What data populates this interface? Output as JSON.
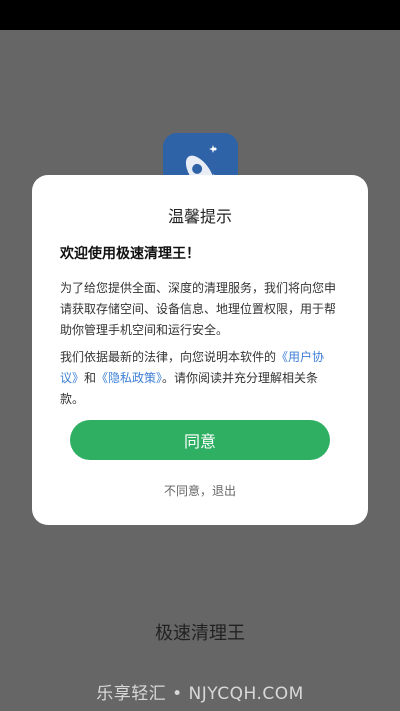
{
  "background": {
    "color": "#666666"
  },
  "app": {
    "icon": "rocket-icon",
    "name": "极速清理王"
  },
  "dialog": {
    "title": "温馨提示",
    "welcome": "欢迎使用极速清理王！",
    "paragraph1": "为了给您提供全面、深度的清理服务，我们将向您申请获取存储空间、设备信息、地理位置权限，用于帮助你管理手机空间和运行安全。",
    "paragraph2_part1": "我们依据最新的法律，向您说明本软件的",
    "user_agreement_link": "《用户协议》",
    "paragraph2_and": "和",
    "privacy_policy_link": "《隐私政策》",
    "paragraph2_part2": "。请你阅读并充分理解相关条款。",
    "agree_button": "同意",
    "disagree_label": "不同意，退出",
    "colors": {
      "agree": "#2eaf62",
      "link": "#3c7fd6"
    }
  },
  "watermark": "乐享轻汇 • NJYCQH.COM"
}
